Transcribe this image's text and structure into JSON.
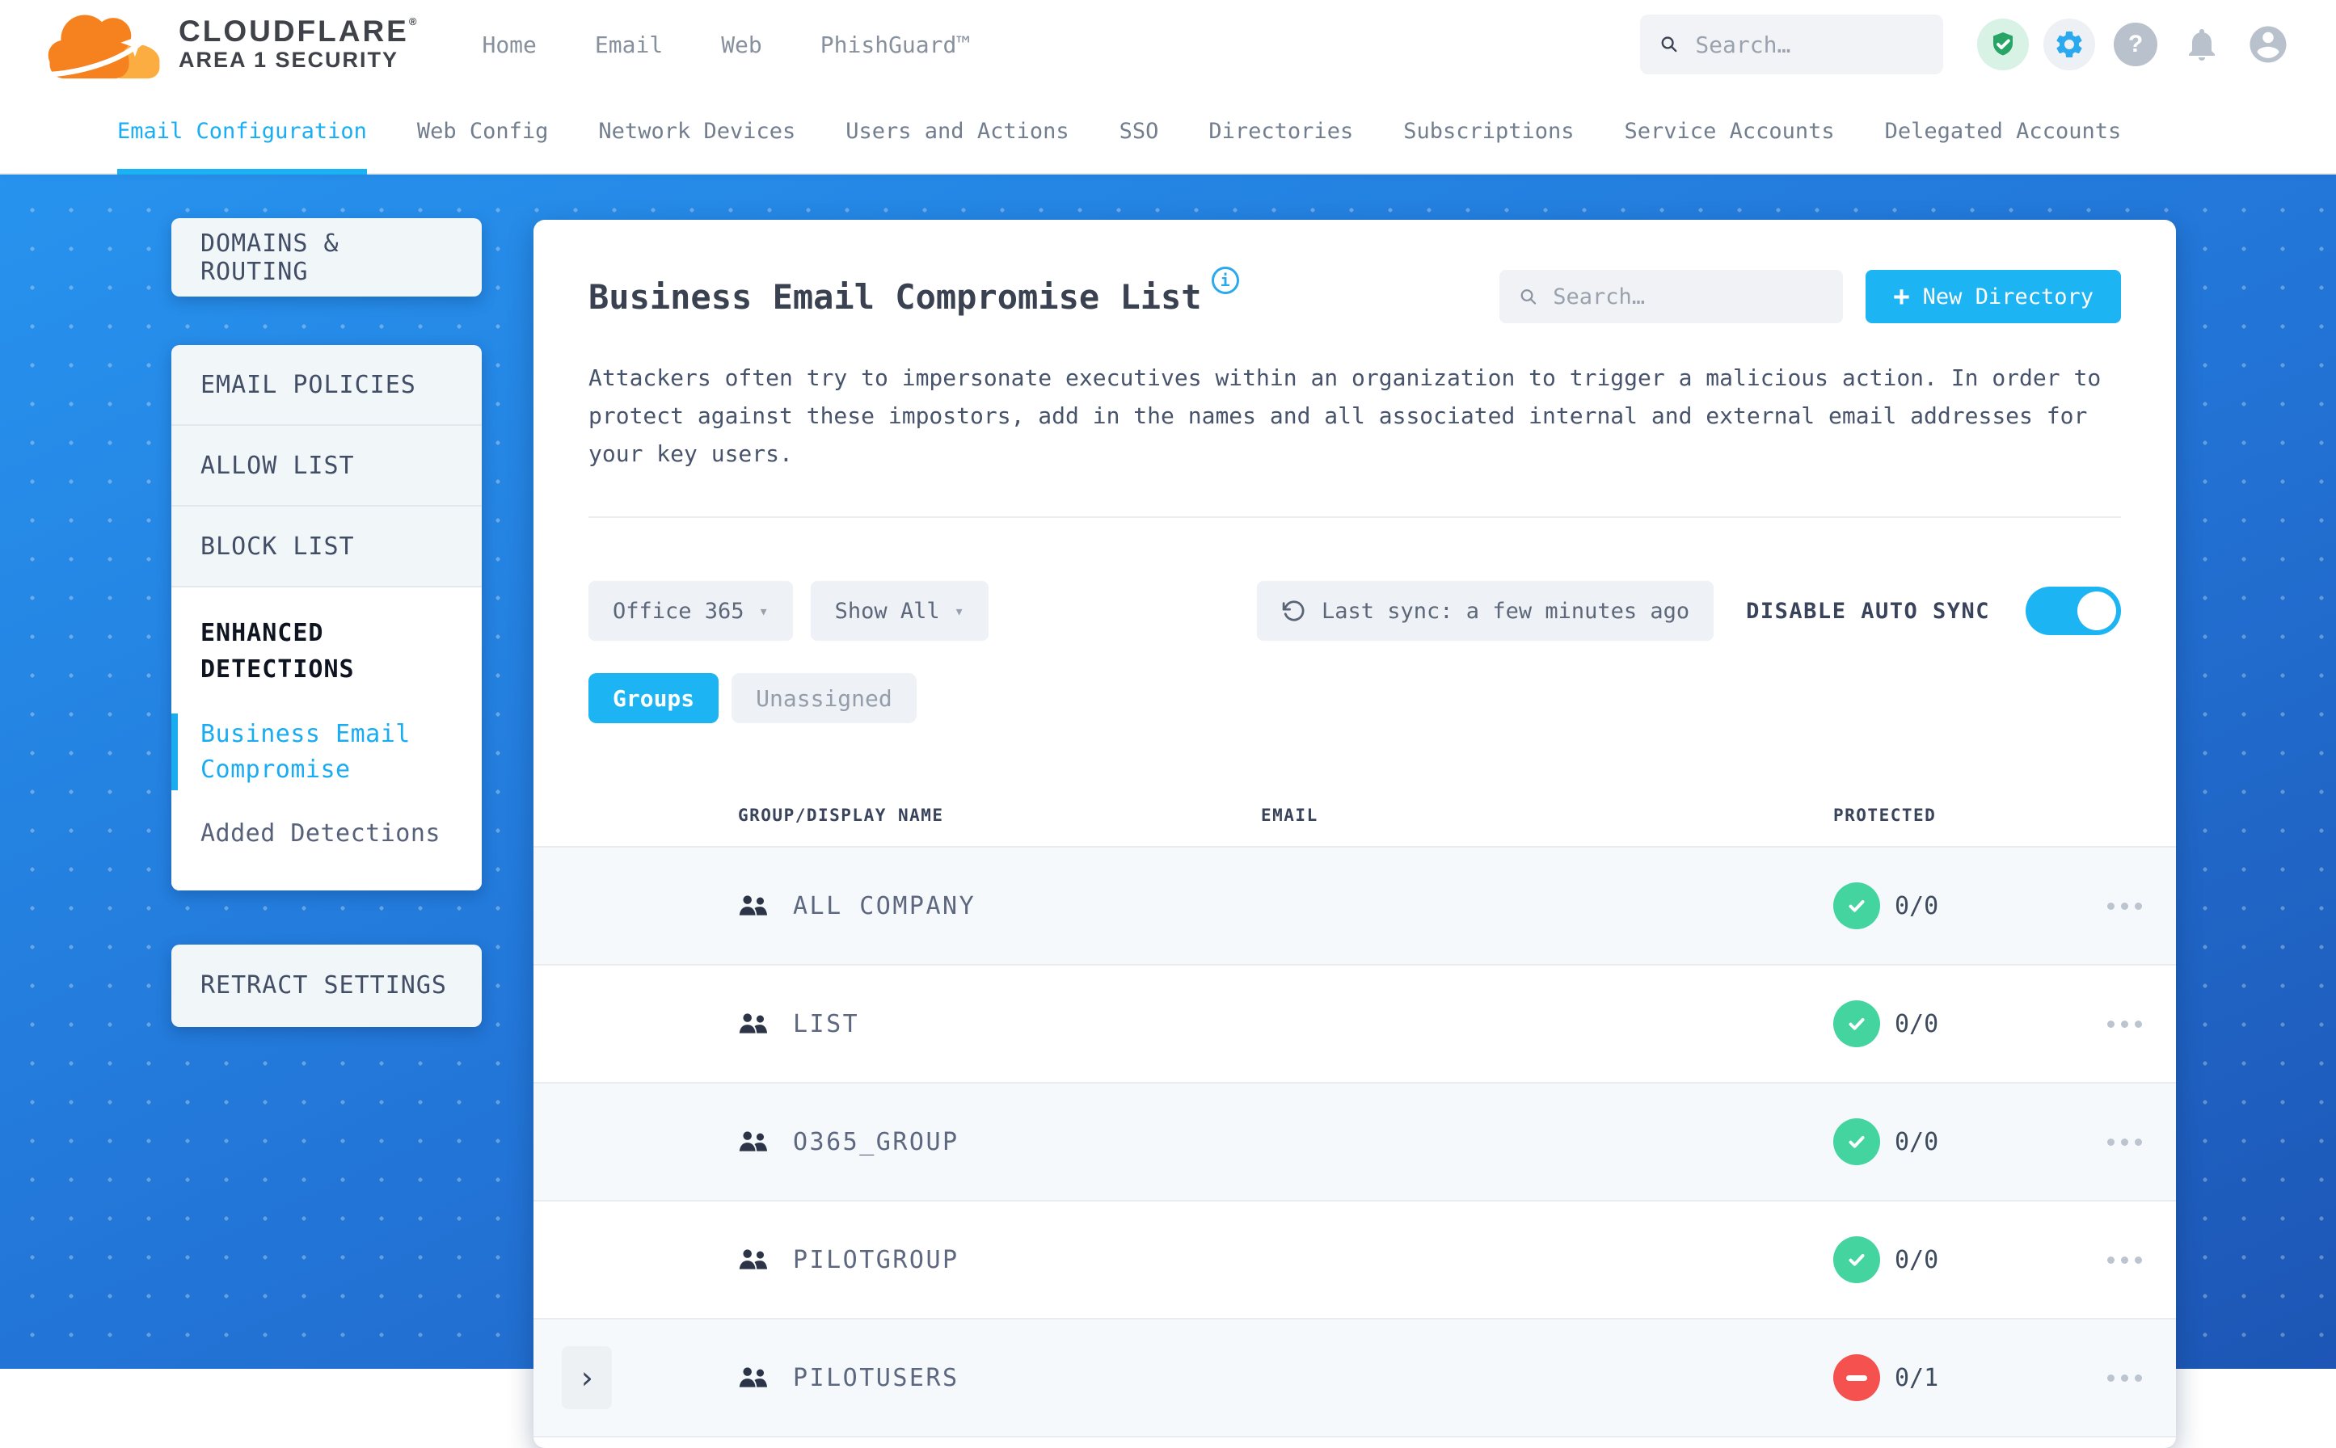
{
  "brand": {
    "name": "CLOUDFLARE",
    "mark": "®",
    "sub": "AREA 1 SECURITY"
  },
  "header": {
    "nav": [
      {
        "label": "Home"
      },
      {
        "label": "Email"
      },
      {
        "label": "Web"
      },
      {
        "label": "PhishGuard™"
      }
    ],
    "search_placeholder": "Search…",
    "icons": [
      "shield-check",
      "settings-gear",
      "help",
      "notifications-bell",
      "user-account"
    ]
  },
  "subnav": {
    "items": [
      {
        "label": "Email Configuration",
        "active": true
      },
      {
        "label": "Web Config",
        "active": false
      },
      {
        "label": "Network Devices",
        "active": false
      },
      {
        "label": "Users and Actions",
        "active": false
      },
      {
        "label": "SSO",
        "active": false
      },
      {
        "label": "Directories",
        "active": false
      },
      {
        "label": "Subscriptions",
        "active": false
      },
      {
        "label": "Service Accounts",
        "active": false
      },
      {
        "label": "Delegated Accounts",
        "active": false
      }
    ]
  },
  "sidebar": {
    "domains_routing": "DOMAINS & ROUTING",
    "policy_items": [
      {
        "label": "EMAIL POLICIES"
      },
      {
        "label": "ALLOW LIST"
      },
      {
        "label": "BLOCK LIST"
      }
    ],
    "enhanced": {
      "label": "ENHANCED DETECTIONS",
      "children": [
        {
          "label": "Business Email Compromise",
          "active": true
        },
        {
          "label": "Added Detections",
          "active": false
        }
      ]
    },
    "retract": "RETRACT SETTINGS"
  },
  "main": {
    "title": "Business Email Compromise List",
    "info_icon": "i",
    "search_placeholder": "Search…",
    "new_directory": {
      "plus": "+",
      "label": "New Directory"
    },
    "description": "Attackers often try to impersonate executives within an organization to trigger a malicious action. In order to protect against these impostors, add in the names and all associated internal and external email addresses for your key users.",
    "filters": {
      "directory_dropdown": "Office 365",
      "show_dropdown": "Show All",
      "caret": "▾",
      "last_sync": "Last sync: a few minutes ago",
      "auto_sync_label": "DISABLE AUTO SYNC",
      "auto_sync_enabled": true
    },
    "tabs": [
      {
        "label": "Groups",
        "active": true
      },
      {
        "label": "Unassigned",
        "active": false
      }
    ],
    "table": {
      "columns": [
        "GROUP/DISPLAY NAME",
        "EMAIL",
        "PROTECTED"
      ],
      "rows": [
        {
          "name": "ALL COMPANY",
          "email": "",
          "protected": "0/0",
          "status": "protected",
          "expandable": false
        },
        {
          "name": "LIST",
          "email": "",
          "protected": "0/0",
          "status": "protected",
          "expandable": false
        },
        {
          "name": "O365_GROUP",
          "email": "",
          "protected": "0/0",
          "status": "protected",
          "expandable": false
        },
        {
          "name": "PILOTGROUP",
          "email": "",
          "protected": "0/0",
          "status": "protected",
          "expandable": false
        },
        {
          "name": "PILOTUSERS",
          "email": "",
          "protected": "0/1",
          "status": "not-protected",
          "expandable": true
        }
      ]
    }
  },
  "colors": {
    "accent": "#1db4f4",
    "status_green": "#43d4a0",
    "status_red": "#f4514f",
    "navy_text": "#39435b",
    "page_blue_top": "#2793ee",
    "page_blue_bottom": "#1d56b5"
  }
}
